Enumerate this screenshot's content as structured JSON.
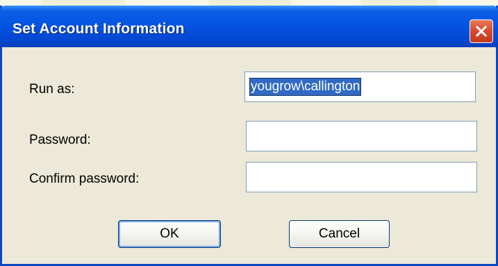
{
  "window": {
    "title": "Set Account Information"
  },
  "form": {
    "run_as_label": "Run as:",
    "run_as_value": "yougrow\\callington",
    "password_label": "Password:",
    "password_value": "",
    "confirm_label": "Confirm password:",
    "confirm_value": ""
  },
  "buttons": {
    "ok_label": "OK",
    "cancel_label": "Cancel"
  },
  "icons": {
    "close": "close-icon"
  },
  "colors": {
    "titlebar": "#0554e3",
    "close_button": "#d9482b",
    "dialog_bg": "#ece9d8",
    "selection": "#316ac5"
  }
}
